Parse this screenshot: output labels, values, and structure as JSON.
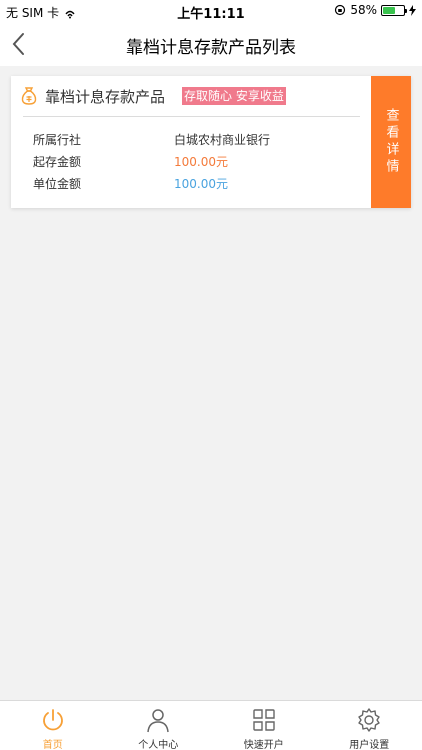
{
  "status_bar": {
    "carrier": "无 SIM 卡",
    "time": "上午11:11",
    "battery_percent": "58%",
    "battery_level": 0.58,
    "wifi_icon": "wifi-icon",
    "lock_icon": "orientation-lock-icon",
    "charging_icon": "charging-icon"
  },
  "nav": {
    "title": "靠档计息存款产品列表",
    "back_icon": "chevron-left-icon"
  },
  "product": {
    "name": "靠档计息存款产品",
    "tag": "存取随心 安享收益",
    "icon": "money-bag-icon",
    "rows": [
      {
        "label": "所属行社",
        "value": "白城农村商业银行",
        "color": "#333333"
      },
      {
        "label": "起存金额",
        "value": "100.00元",
        "color": "#f47a3a"
      },
      {
        "label": "单位金额",
        "value": "100.00元",
        "color": "#4aa3df"
      }
    ],
    "detail_button": "查看详情"
  },
  "tabs": [
    {
      "label": "首页",
      "icon": "power-icon",
      "active": true
    },
    {
      "label": "个人中心",
      "icon": "user-icon",
      "active": false
    },
    {
      "label": "快速开户",
      "icon": "grid-icon",
      "active": false
    },
    {
      "label": "用户设置",
      "icon": "gear-icon",
      "active": false
    }
  ],
  "colors": {
    "accent": "#f7a036",
    "detail_button": "#fe7b2a",
    "tag_bg": "#f07a8c"
  }
}
